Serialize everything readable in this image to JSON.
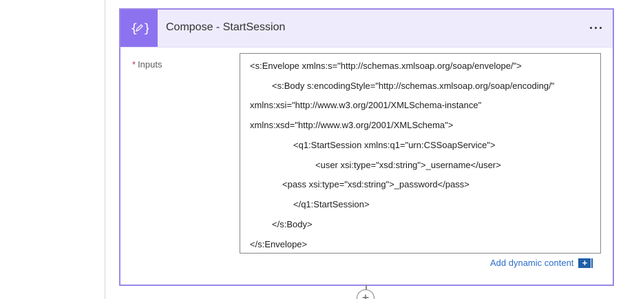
{
  "card": {
    "title": "Compose - StartSession",
    "icon": "compose-braces-icon",
    "more_label": "..."
  },
  "field": {
    "required_marker": "*",
    "label": "Inputs"
  },
  "inputs_lines": [
    "<s:Envelope xmlns:s=\"http://schemas.xmlsoap.org/soap/envelope/\">",
    "<s:Body s:encodingStyle=\"http://schemas.xmlsoap.org/soap/encoding/\"",
    "xmlns:xsi=\"http://www.w3.org/2001/XMLSchema-instance\"",
    "xmlns:xsd=\"http://www.w3.org/2001/XMLSchema\">",
    "<q1:StartSession xmlns:q1=\"urn:CSSoapService\">",
    "<user xsi:type=\"xsd:string\">_username</user>",
    "<pass xsi:type=\"xsd:string\">_password</pass>",
    "</q1:StartSession>",
    "</s:Body>",
    "</s:Envelope>"
  ],
  "dynamic": {
    "label": "Add dynamic content",
    "plus": "+"
  },
  "add_step": "+",
  "colors": {
    "accent": "#8d72f0",
    "card_border": "#9b87e8",
    "header_bg": "#eeebfc",
    "link": "#2c6ecb"
  }
}
